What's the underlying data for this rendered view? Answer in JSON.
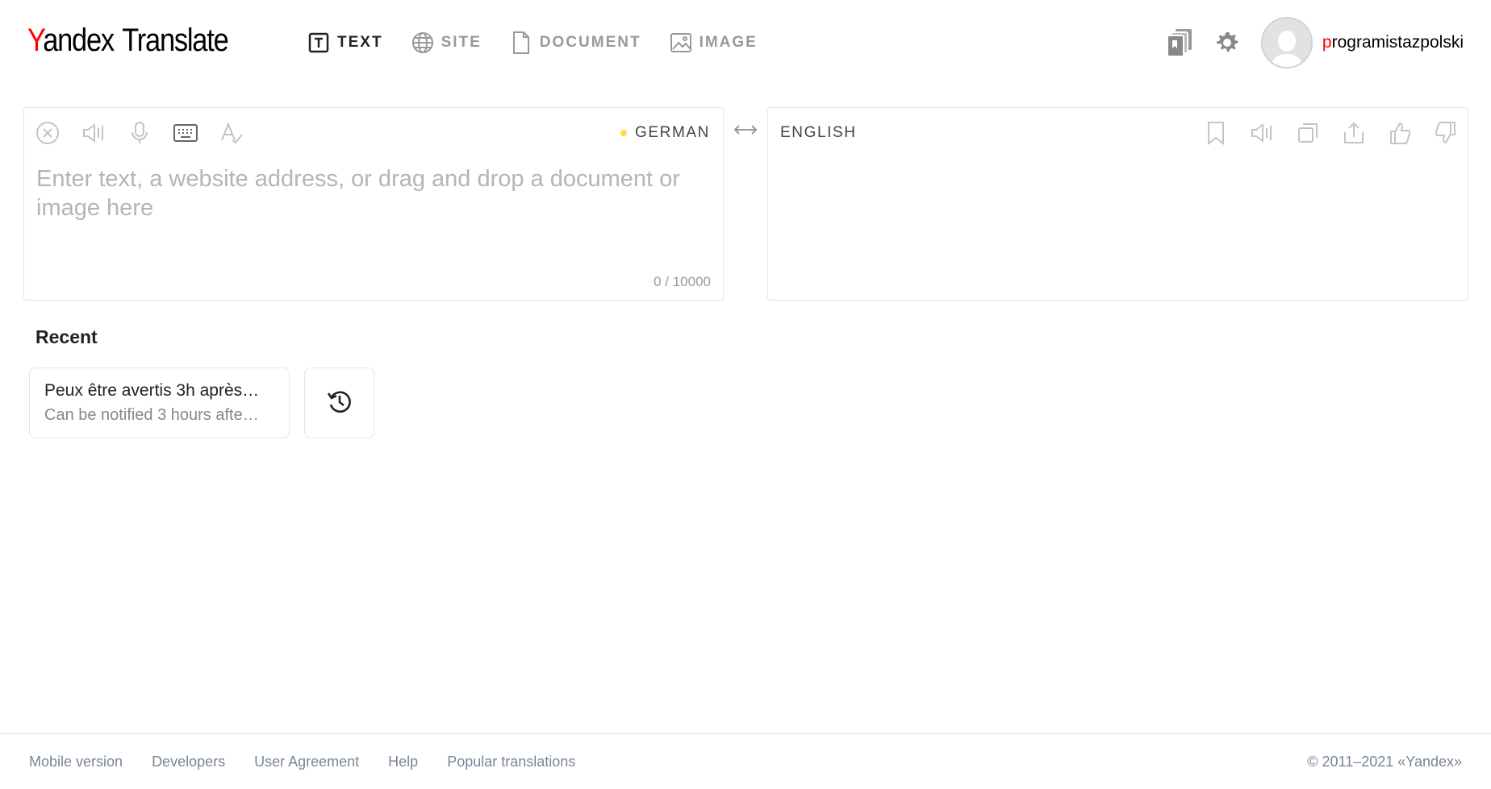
{
  "brand": {
    "logo_y": "Y",
    "logo_rest": "andex",
    "logo_translate": "Translate"
  },
  "modes": [
    {
      "label": "TEXT",
      "icon": "text-box-icon",
      "active": true
    },
    {
      "label": "SITE",
      "icon": "globe-icon",
      "active": false
    },
    {
      "label": "DOCUMENT",
      "icon": "document-icon",
      "active": false
    },
    {
      "label": "IMAGE",
      "icon": "image-icon",
      "active": false
    }
  ],
  "header": {
    "icons": [
      "collections-icon",
      "settings-gear-icon"
    ],
    "user": {
      "first_letter": "p",
      "rest": "rogramistazpolski"
    }
  },
  "source": {
    "language": "GERMAN",
    "placeholder": "Enter text, a website address, or drag and drop a document or image here",
    "value": "",
    "counter": "0 / 10000",
    "tools": [
      "clear-icon",
      "listen-icon",
      "microphone-icon",
      "keyboard-icon",
      "spellcheck-icon"
    ]
  },
  "target": {
    "language": "ENGLISH",
    "tools": [
      "bookmark-icon",
      "listen-icon",
      "copy-icon",
      "share-icon",
      "thumbs-up-icon",
      "thumbs-down-icon"
    ]
  },
  "recent": {
    "title": "Recent",
    "items": [
      {
        "source": "Peux être avertis 3h après…",
        "translation": "Can be notified 3 hours afte…"
      }
    ],
    "history_icon": "history-icon"
  },
  "footer": {
    "links": [
      "Mobile version",
      "Developers",
      "User Agreement",
      "Help",
      "Popular translations"
    ],
    "copyright": "© 2011–2021 «Yandex»"
  },
  "colors": {
    "brand_red": "#ff0000",
    "accent_yellow": "#ffdb4d",
    "muted": "#999999",
    "footer_link": "#7a8597"
  }
}
